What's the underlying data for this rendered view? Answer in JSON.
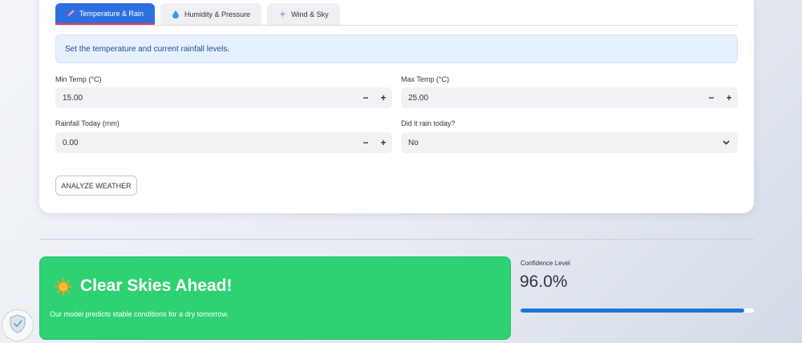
{
  "tabs": [
    {
      "label": "Temperature & Rain",
      "icon": "thermometer-icon",
      "active": true
    },
    {
      "label": "Humidity & Pressure",
      "icon": "droplet-icon",
      "active": false
    },
    {
      "label": "Wind & Sky",
      "icon": "sparkle-icon",
      "active": false
    }
  ],
  "info_text": "Set the temperature and current rainfall levels.",
  "fields": {
    "min_temp": {
      "label": "Min Temp (°C)",
      "value": "15.00"
    },
    "max_temp": {
      "label": "Max Temp (°C)",
      "value": "25.00"
    },
    "rainfall": {
      "label": "Rainfall Today (mm)",
      "value": "0.00"
    },
    "rain_today": {
      "label": "Did it rain today?",
      "value": "No"
    }
  },
  "stepper": {
    "minus": "−",
    "plus": "+"
  },
  "analyze_button": "ANALYZE WEATHER",
  "result": {
    "icon": "sun-icon",
    "title": "Clear Skies Ahead!",
    "message": "Our model predicts stable conditions for a dry tomorrow.",
    "color": "#2ed272"
  },
  "confidence": {
    "label": "Confidence Level",
    "value": "96.0%",
    "fraction": 0.96
  },
  "colors": {
    "accent": "#2e6fe0",
    "progress": "#1f73d6"
  }
}
